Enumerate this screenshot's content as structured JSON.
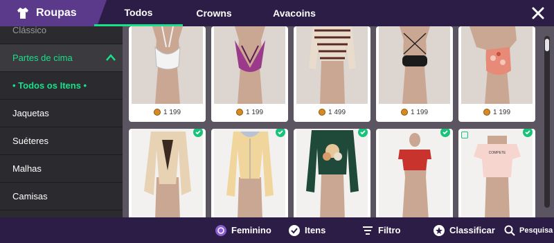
{
  "header": {
    "section_title": "Roupas",
    "tabs": [
      {
        "label": "Todos",
        "active": true
      },
      {
        "label": "Crowns",
        "active": false
      },
      {
        "label": "Avacoins",
        "active": false
      }
    ],
    "accent_color": "#19e08a"
  },
  "sidebar": {
    "items": [
      {
        "label": "Clássico"
      },
      {
        "label": "Partes de cima",
        "expanded": true
      },
      {
        "label": "• Todos os Itens •",
        "selected": true
      },
      {
        "label": "Jaquetas"
      },
      {
        "label": "Suéteres"
      },
      {
        "label": "Malhas"
      },
      {
        "label": "Camisas"
      }
    ]
  },
  "items": {
    "row1": [
      {
        "price": "1 199",
        "icon": "halter-top"
      },
      {
        "price": "1 199",
        "icon": "purple-wrap-top"
      },
      {
        "price": "1 499",
        "icon": "striped-sweater"
      },
      {
        "price": "1 199",
        "icon": "black-bandeau"
      },
      {
        "price": "1 199",
        "icon": "floral-halter"
      }
    ],
    "row2": [
      {
        "owned": true,
        "icon": "beige-jacket"
      },
      {
        "owned": true,
        "icon": "yellow-hoodie"
      },
      {
        "owned": true,
        "icon": "green-floral-sweater"
      },
      {
        "owned": true,
        "icon": "red-crop-top"
      },
      {
        "owned": true,
        "new": true,
        "icon": "pink-tee",
        "shirt_text": "COMPETE"
      }
    ],
    "sweater_text": "",
    "crop_text": "",
    "brand_text": ""
  },
  "toolbar": {
    "gender_label": "Feminino",
    "items_label": "Itens",
    "filter_label": "Filtro",
    "sort_label": "Classificar",
    "search_label": "Pesquisa"
  }
}
